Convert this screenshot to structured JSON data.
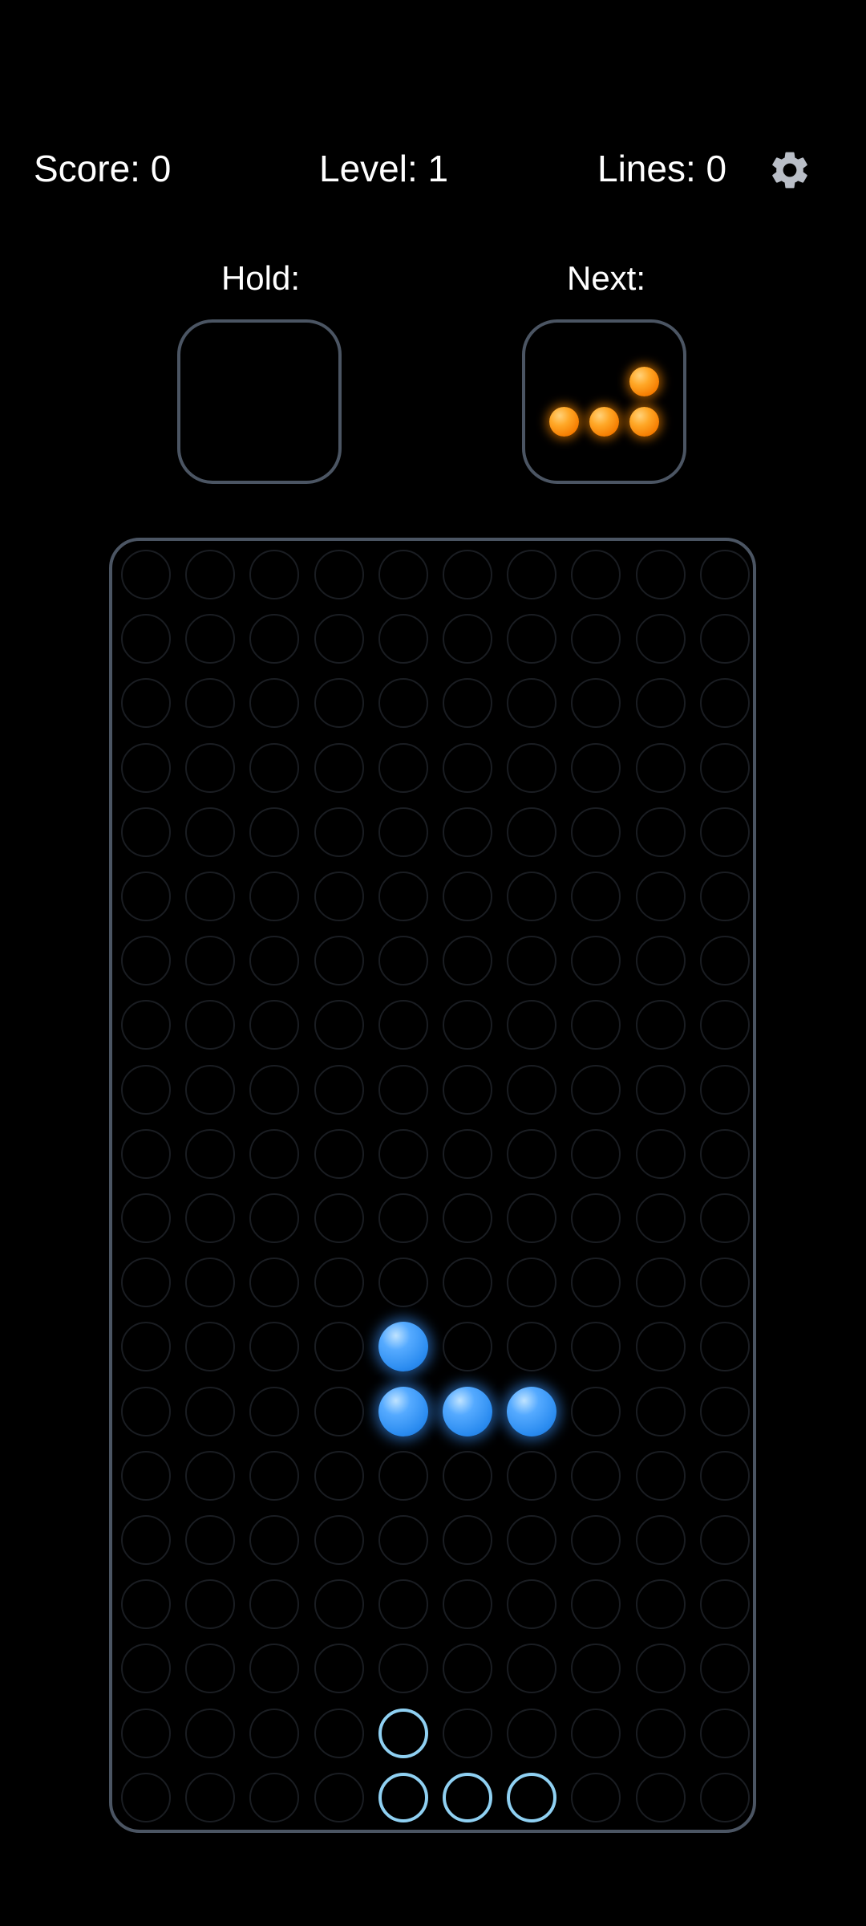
{
  "header": {
    "score_label": "Score: 0",
    "level_label": "Level: 1",
    "lines_label": "Lines: 0",
    "settings_icon": "gear-icon"
  },
  "hold": {
    "label": "Hold:",
    "piece": null
  },
  "next": {
    "label": "Next:",
    "piece": "L",
    "cells": [
      [
        2,
        0
      ],
      [
        0,
        1
      ],
      [
        1,
        1
      ],
      [
        2,
        1
      ]
    ],
    "color": "#ff9800"
  },
  "board": {
    "columns": 10,
    "rows": 20,
    "active_piece": {
      "type": "J",
      "color": "#2b8cf0",
      "cells": [
        [
          4,
          12
        ],
        [
          4,
          13
        ],
        [
          5,
          13
        ],
        [
          6,
          13
        ]
      ]
    },
    "ghost_piece": {
      "color": "#8fd0f2",
      "cells": [
        [
          4,
          18
        ],
        [
          4,
          19
        ],
        [
          5,
          19
        ],
        [
          6,
          19
        ]
      ]
    }
  },
  "colors": {
    "background": "#000000",
    "frame": "#4b5563",
    "empty_cell": "#1a1d22",
    "text": "#ffffff"
  }
}
